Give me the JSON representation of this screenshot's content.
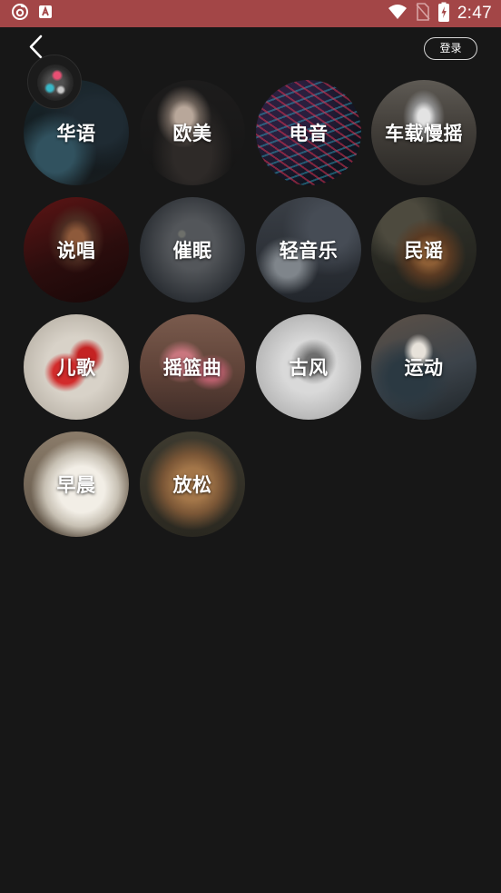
{
  "status_bar": {
    "time": "2:47",
    "icons": [
      "netease-cloud-music-icon",
      "app-store-icon",
      "wifi-icon",
      "no-sim-icon",
      "battery-charging-icon"
    ],
    "background_color": "#a34647"
  },
  "header": {
    "back_icon": "chevron-left-icon",
    "login_label": "登录"
  },
  "categories": [
    {
      "label": "华语"
    },
    {
      "label": "欧美"
    },
    {
      "label": "电音"
    },
    {
      "label": "车载慢摇"
    },
    {
      "label": "说唱"
    },
    {
      "label": "催眠"
    },
    {
      "label": "轻音乐"
    },
    {
      "label": "民谣"
    },
    {
      "label": "儿歌"
    },
    {
      "label": "摇篮曲"
    },
    {
      "label": "古风"
    },
    {
      "label": "运动"
    },
    {
      "label": "早晨"
    },
    {
      "label": "放松"
    }
  ],
  "colors": {
    "page_background": "#171717",
    "text": "#ffffff"
  }
}
